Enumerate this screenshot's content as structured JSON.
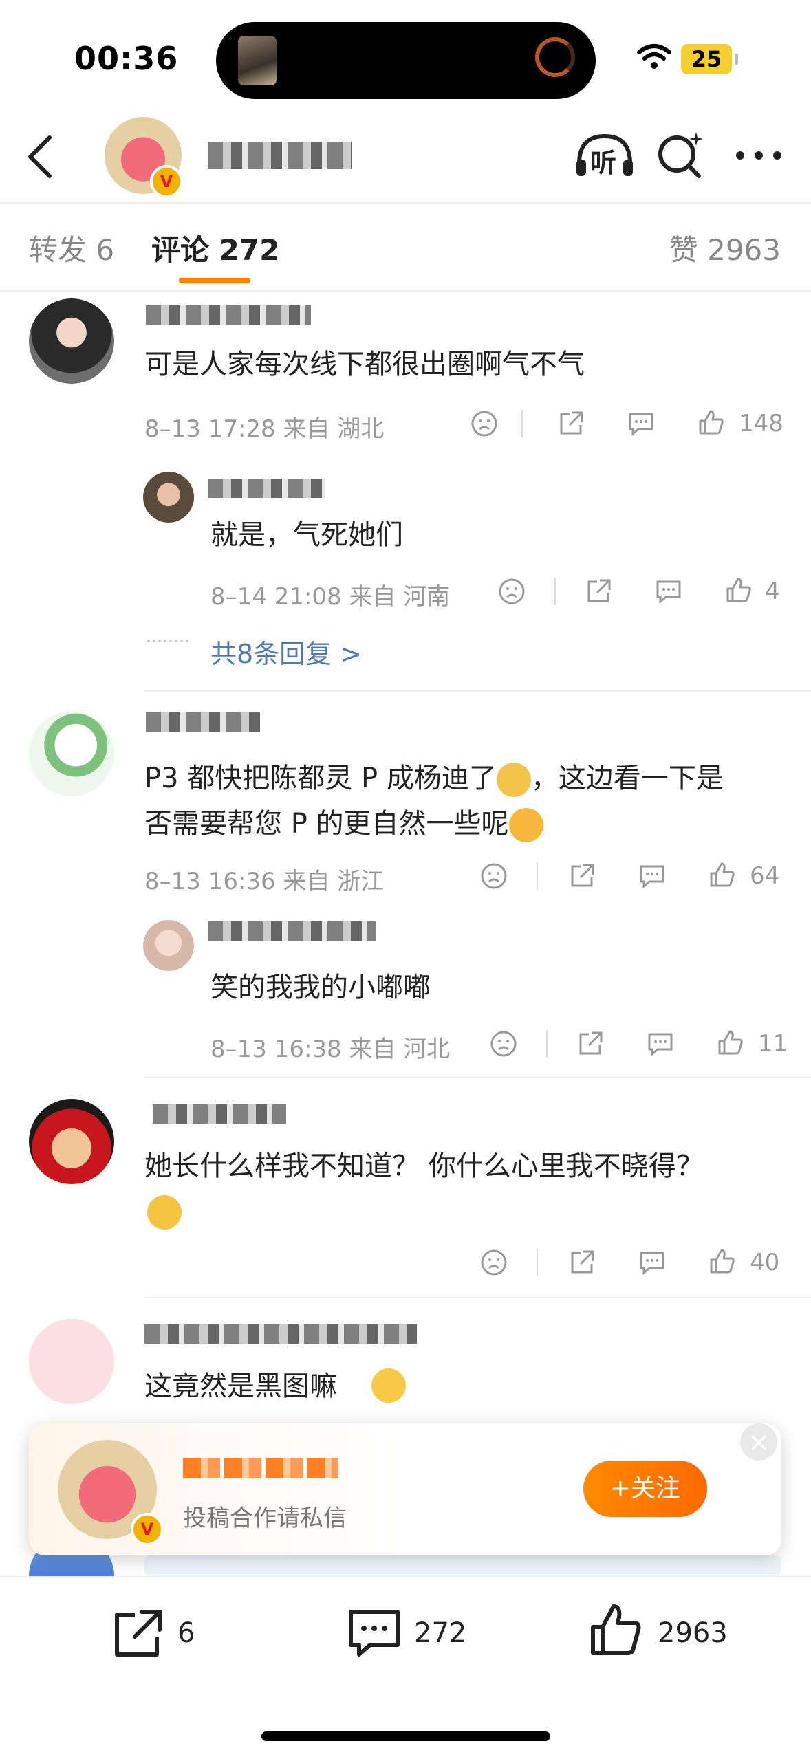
{
  "status_bar": {
    "time": "00:36",
    "battery": "25"
  },
  "header": {
    "listen_label": "听"
  },
  "tabs": {
    "repost": "转发 6",
    "comment": "评论 272",
    "like": "赞 2963"
  },
  "comments": [
    {
      "text": "可是人家每次线下都很出圈啊气不气",
      "meta": "8–13 17:28 来自 湖北",
      "likes": "148",
      "reply": {
        "text": "就是，气死她们",
        "meta": "8–14 21:08 来自 河南",
        "likes": "4"
      },
      "more_replies": "共8条回复 >"
    },
    {
      "text_line1": "P3 都快把陈都灵 P 成杨迪了",
      "text_line1_tail": "，这边看一下是",
      "text_line2": "否需要帮您 P 的更自然一些呢",
      "meta": "8–13 16:36 来自 浙江",
      "likes": "64",
      "reply": {
        "text": "笑的我我的小嘟嘟",
        "meta": "8–13 16:38 来自 河北",
        "likes": "11"
      }
    },
    {
      "text": "她长什么样我不知道？ 你什么心里我不晓得？",
      "likes": "40"
    },
    {
      "text": "这竟然是黑图嘛"
    }
  ],
  "popup": {
    "subtitle": "投稿合作请私信",
    "follow_label": "+关注",
    "close_label": "×"
  },
  "bottom_bar": {
    "repost_count": "6",
    "comment_count": "272",
    "like_count": "2963"
  },
  "colors": {
    "accent": "#ff8200",
    "link": "#4f7ab3",
    "badge": "#f3b200"
  }
}
